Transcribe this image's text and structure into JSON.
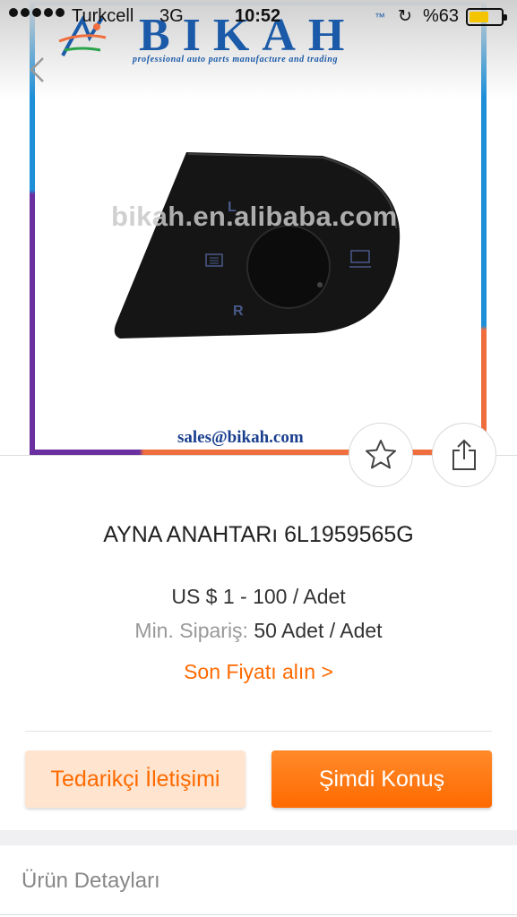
{
  "status_bar": {
    "carrier": "Turkcell",
    "network": "3G",
    "time": "10:52",
    "battery_percent": "%63",
    "battery_level": 0.63,
    "battery_color": "#f5c400"
  },
  "product_image": {
    "brand_name": "BIKAH",
    "brand_tm": "™",
    "brand_tagline": "professional auto parts manufacture and trading",
    "watermark": "bikah.en.alibaba.com",
    "email": "sales@bikah.com",
    "switch_labels": {
      "left": "L",
      "right": "R"
    }
  },
  "product": {
    "title": "AYNA ANAHTARı 6L1959565G",
    "price": "US $ 1 - 100 / Adet",
    "moq_label": "Min. Sipariş:",
    "moq_value": "50 Adet / Adet",
    "latest_price_link": "Son Fiyatı alın >"
  },
  "actions": {
    "contact_supplier": "Tedarikçi İletişimi",
    "chat_now": "Şimdi Konuş"
  },
  "details": {
    "label": "Ürün Detayları"
  },
  "colors": {
    "accent": "#ff6a00",
    "brand_blue": "#1a5aa8"
  },
  "icons": {
    "back": "chevron-left-icon",
    "favorite": "star-icon",
    "share": "share-icon"
  }
}
